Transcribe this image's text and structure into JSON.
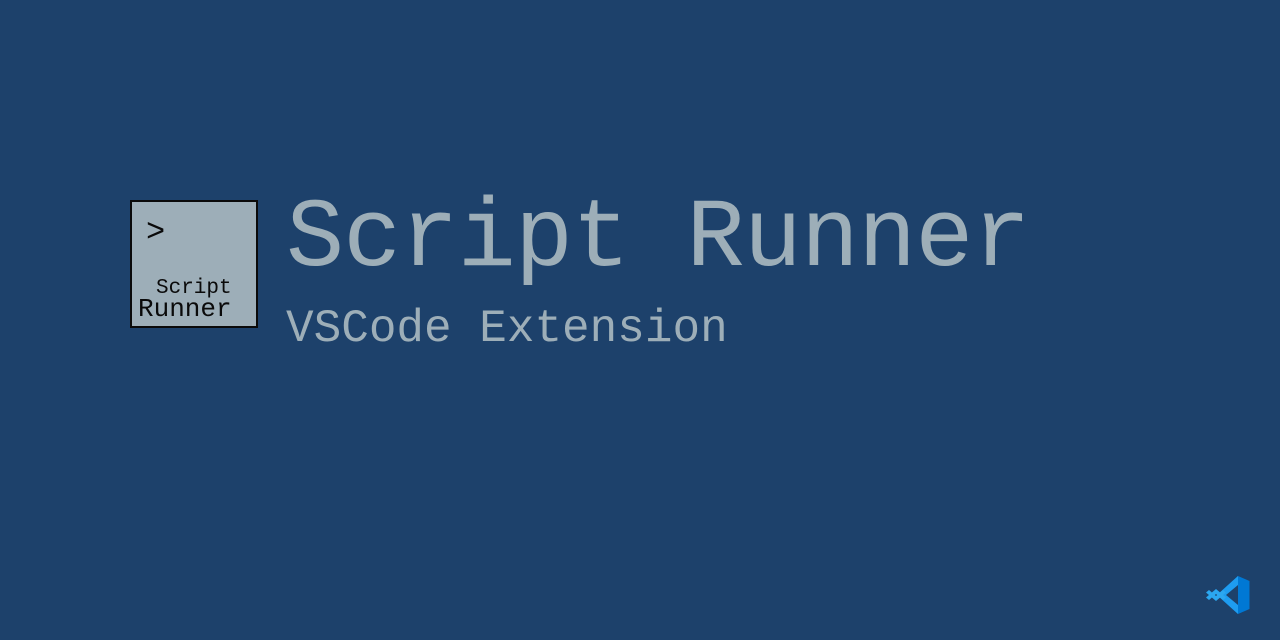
{
  "logo": {
    "prompt": ">",
    "line1": "Script",
    "line2": "Runner"
  },
  "title": "Script Runner",
  "subtitle": "VSCode Extension",
  "colors": {
    "background": "#1d416b",
    "foreground": "#9daeb8",
    "logoBg": "#9daeb8",
    "logoBorder": "#0a0a0a",
    "logoText": "#0a0a0a"
  }
}
